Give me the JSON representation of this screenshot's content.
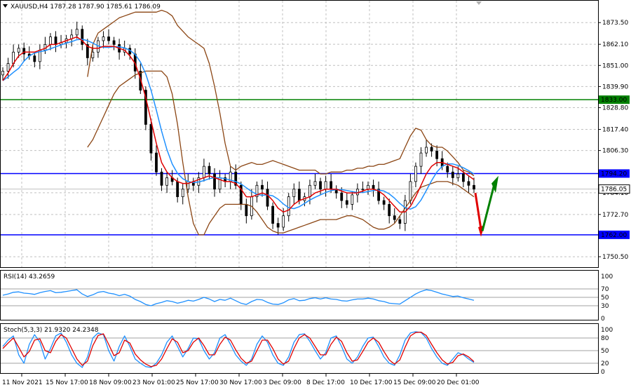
{
  "header": {
    "symbol_line": "XAUUSD,H4  1787.28 1787.90 1785.61 1786.09"
  },
  "main_chart": {
    "price_range": [
      1745.0,
      1885.0
    ],
    "price_ticks": [
      "1873.50",
      "1862.10",
      "1851.00",
      "1839.90",
      "1828.80",
      "1817.40",
      "1806.30",
      "1784.10",
      "1772.70",
      "1750.50"
    ],
    "levels": [
      {
        "label": "1833.00",
        "price": 1833.0,
        "color": "#008000"
      },
      {
        "label": "1794.20",
        "price": 1794.2,
        "color": "#0000ff"
      },
      {
        "label": "1762.00",
        "price": 1762.0,
        "color": "#0000ff"
      }
    ],
    "current_price_label": "1786.05",
    "current_price": 1786.05,
    "closes": [
      1848,
      1852,
      1858,
      1860,
      1857,
      1856,
      1853,
      1859,
      1862,
      1866,
      1862,
      1863,
      1865,
      1867,
      1870,
      1862,
      1855,
      1858,
      1864,
      1866,
      1864,
      1862,
      1858,
      1860,
      1857,
      1848,
      1838,
      1820,
      1805,
      1795,
      1788,
      1792,
      1790,
      1782,
      1786,
      1790,
      1788,
      1792,
      1798,
      1794,
      1786,
      1792,
      1790,
      1795,
      1788,
      1778,
      1772,
      1782,
      1788,
      1786,
      1777,
      1768,
      1766,
      1772,
      1782,
      1786,
      1780,
      1782,
      1788,
      1790,
      1786,
      1790,
      1786,
      1784,
      1780,
      1778,
      1783,
      1786,
      1786,
      1788,
      1786,
      1780,
      1778,
      1772,
      1770,
      1768,
      1780,
      1790,
      1798,
      1805,
      1808,
      1806,
      1802,
      1798,
      1795,
      1792,
      1794,
      1790,
      1788,
      1786
    ],
    "bb_upper": [
      1845,
      1862,
      1868,
      1870,
      1872,
      1874,
      1876,
      1877,
      1878,
      1879,
      1879,
      1879,
      1879,
      1879,
      1880,
      1879,
      1877,
      1872,
      1869,
      1866,
      1864,
      1862,
      1860,
      1852,
      1840,
      1826,
      1810,
      1798,
      1796,
      1798,
      1799,
      1800,
      1799,
      1799,
      1800,
      1801,
      1800,
      1799,
      1798,
      1797,
      1796,
      1796,
      1796,
      1796,
      1794,
      1794,
      1795,
      1795,
      1795,
      1796,
      1796,
      1797,
      1797,
      1798,
      1798,
      1799,
      1799,
      1800,
      1801,
      1802,
      1808,
      1814,
      1818,
      1817,
      1812,
      1809,
      1808,
      1808,
      1806,
      1803,
      1800,
      1796,
      1795,
      1793
    ],
    "bb_lower": [
      1808,
      1812,
      1818,
      1824,
      1830,
      1836,
      1840,
      1842,
      1844,
      1846,
      1847,
      1848,
      1848,
      1848,
      1848,
      1845,
      1836,
      1820,
      1800,
      1782,
      1768,
      1762,
      1762,
      1768,
      1772,
      1776,
      1778,
      1778,
      1778,
      1778,
      1778,
      1777,
      1774,
      1770,
      1766,
      1764,
      1763,
      1763,
      1764,
      1765,
      1766,
      1767,
      1768,
      1769,
      1770,
      1770,
      1770,
      1770,
      1771,
      1772,
      1772,
      1771,
      1770,
      1768,
      1766,
      1765,
      1765,
      1766,
      1768,
      1772,
      1776,
      1780,
      1784,
      1787,
      1788,
      1789,
      1790,
      1790,
      1790,
      1789,
      1788,
      1786,
      1784,
      1782
    ],
    "sma_fast": [
      1843,
      1847,
      1852,
      1856,
      1858,
      1858,
      1858,
      1859,
      1860,
      1862,
      1862,
      1863,
      1864,
      1865,
      1866,
      1864,
      1861,
      1860,
      1860,
      1861,
      1861,
      1861,
      1860,
      1859,
      1856,
      1852,
      1844,
      1834,
      1822,
      1810,
      1800,
      1795,
      1792,
      1790,
      1789,
      1789,
      1790,
      1791,
      1792,
      1793,
      1792,
      1791,
      1790,
      1790,
      1789,
      1786,
      1782,
      1782,
      1783,
      1784,
      1783,
      1780,
      1776,
      1774,
      1775,
      1778,
      1780,
      1781,
      1782,
      1784,
      1785,
      1786,
      1786,
      1786,
      1785,
      1784,
      1784,
      1784,
      1785,
      1786,
      1786,
      1785,
      1783,
      1780,
      1777,
      1774,
      1774,
      1777,
      1782,
      1788,
      1794,
      1798,
      1800,
      1800,
      1799,
      1798,
      1797,
      1795,
      1793,
      1791
    ]
  },
  "rsi": {
    "label": "RSI(14) 43.2659",
    "ticks": [
      "100",
      "70",
      "50",
      "30",
      "0"
    ],
    "levels": [
      70,
      50,
      30
    ],
    "values": [
      55,
      58,
      62,
      63,
      60,
      59,
      57,
      61,
      64,
      66,
      61,
      62,
      64,
      66,
      68,
      58,
      52,
      56,
      62,
      64,
      60,
      58,
      54,
      57,
      53,
      45,
      40,
      33,
      30,
      35,
      38,
      42,
      40,
      36,
      39,
      43,
      41,
      45,
      50,
      46,
      40,
      45,
      43,
      48,
      42,
      36,
      33,
      40,
      45,
      44,
      38,
      34,
      33,
      37,
      44,
      47,
      42,
      43,
      47,
      49,
      46,
      49,
      46,
      45,
      42,
      41,
      44,
      46,
      46,
      48,
      46,
      42,
      40,
      36,
      35,
      34,
      42,
      50,
      58,
      64,
      68,
      66,
      62,
      58,
      55,
      52,
      53,
      49,
      46,
      43
    ]
  },
  "stoch": {
    "label": "Stoch(5,3,3) 21.9320 24.2348",
    "ticks": [
      "100",
      "80",
      "50",
      "20",
      "0"
    ],
    "levels": [
      80,
      50,
      20
    ],
    "main": [
      60,
      75,
      85,
      40,
      20,
      65,
      88,
      70,
      30,
      55,
      85,
      92,
      70,
      40,
      20,
      10,
      35,
      80,
      92,
      88,
      50,
      25,
      60,
      85,
      60,
      30,
      20,
      12,
      10,
      20,
      40,
      70,
      85,
      60,
      35,
      55,
      80,
      78,
      50,
      30,
      45,
      80,
      88,
      65,
      40,
      25,
      15,
      30,
      65,
      85,
      70,
      40,
      20,
      15,
      35,
      70,
      88,
      90,
      72,
      50,
      30,
      45,
      80,
      85,
      60,
      30,
      20,
      35,
      60,
      80,
      82,
      60,
      35,
      20,
      15,
      40,
      75,
      92,
      95,
      93,
      80,
      55,
      35,
      20,
      15,
      30,
      45,
      40,
      30,
      22
    ],
    "signal": [
      55,
      68,
      80,
      58,
      35,
      48,
      75,
      78,
      50,
      45,
      72,
      88,
      80,
      55,
      30,
      15,
      25,
      62,
      86,
      90,
      65,
      38,
      45,
      75,
      68,
      42,
      28,
      18,
      12,
      15,
      30,
      55,
      78,
      70,
      45,
      50,
      70,
      80,
      62,
      40,
      40,
      65,
      82,
      75,
      52,
      32,
      20,
      25,
      50,
      75,
      75,
      55,
      30,
      18,
      25,
      55,
      80,
      88,
      80,
      60,
      40,
      40,
      65,
      82,
      72,
      45,
      25,
      28,
      48,
      70,
      80,
      70,
      48,
      28,
      18,
      28,
      58,
      85,
      93,
      94,
      86,
      65,
      45,
      28,
      18,
      22,
      38,
      42,
      35,
      24
    ]
  },
  "time_labels": [
    "11 Nov 2021",
    "15 Nov 17:00",
    "18 Nov 09:00",
    "23 Nov 01:00",
    "25 Nov 17:00",
    "30 Nov 17:00",
    "3 Dec 09:00",
    "8 Dec 17:00",
    "10 Dec 17:00",
    "15 Dec 09:00",
    "20 Dec 01:00"
  ],
  "colors": {
    "grid": "#c0c0c0",
    "candle": "#000000",
    "bollinger": "#8b4513",
    "ma_fast": "#e00000",
    "ma_slow": "#1e90ff",
    "rsi_line": "#1e90ff",
    "stoch_main": "#1e90ff",
    "stoch_signal": "#e00000",
    "arrow_down": "#e00000",
    "arrow_up": "#008000",
    "level_green": "#008000",
    "level_blue": "#0000ff",
    "price_tag_bg": "#ffffff"
  },
  "icons": {
    "menu": "triangle-down-icon",
    "scroll": "triangle-down-icon"
  }
}
